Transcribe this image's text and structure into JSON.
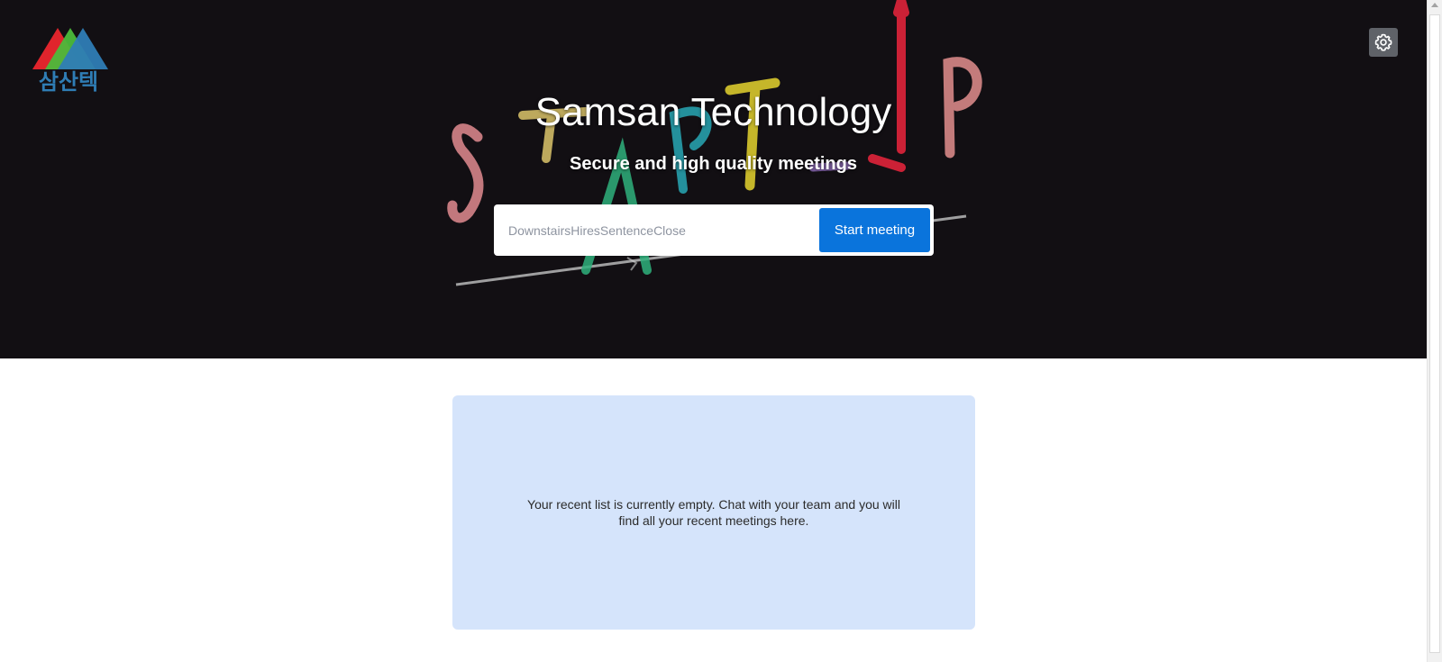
{
  "app": {
    "title": "Samsan Technology",
    "subtitle": "Secure and high quality meetings",
    "logo_text": "삼산텍"
  },
  "join": {
    "room_value": "",
    "room_placeholder": "DownstairsHiresSentenceClose",
    "start_label": "Start meeting"
  },
  "hero": {
    "background_wordmark": "START-UP"
  },
  "recent": {
    "empty_message": "Your recent list is currently empty. Chat with your team and you will find all your recent meetings here."
  },
  "icons": {
    "settings": "gear-icon",
    "logo": "mountain-logo"
  },
  "colors": {
    "hero_bg": "#120f13",
    "accent": "#0a74dc",
    "recent_bg": "#d5e4fb",
    "logo_red": "#e0242c",
    "logo_green": "#4cbb3b",
    "logo_blue": "#2f7db5"
  }
}
